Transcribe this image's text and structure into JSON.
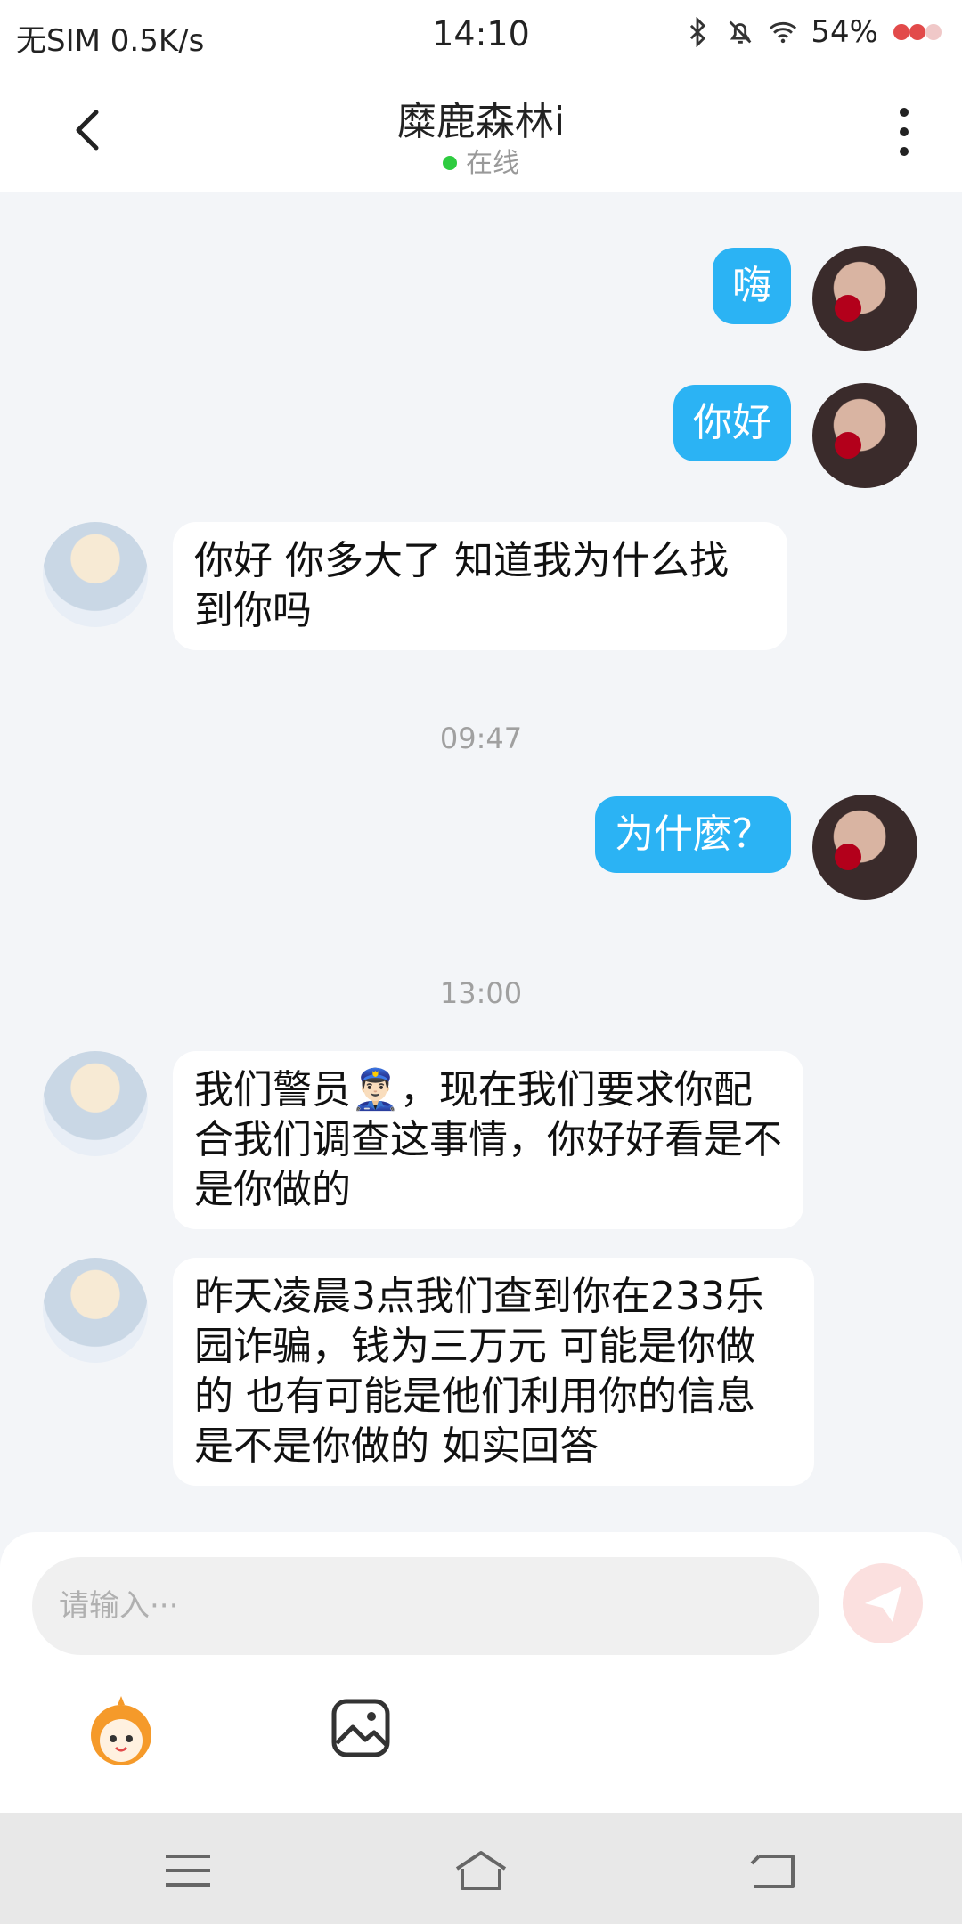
{
  "status_bar": {
    "carrier": "无SIM",
    "speed": "0.5K/s",
    "time": "14:10",
    "battery": "54%"
  },
  "header": {
    "title": "糜鹿森林i",
    "status": "在线"
  },
  "messages": {
    "m1": "嗨",
    "m2": "你好",
    "m3": "你好 你多大了 知道我为什么找到你吗",
    "t1": "09:47",
    "m4": "为什麼？",
    "t2": "13:00",
    "m5": "我们警员👮🏻‍♂️，现在我们要求你配合我们调查这事情，你好好看是不是你做的",
    "m6": "昨天凌晨3点我们查到你在233乐园诈骗，钱为三万元 可能是你做的 也有可能是他们利用你的信息 是不是你做的 如实回答"
  },
  "composer": {
    "placeholder": "请输入···"
  },
  "colors": {
    "outgoing_bubble": "#2bb3f4",
    "incoming_bubble": "#ffffff",
    "online_dot": "#2ecc40",
    "send_button": "#fbe0df"
  },
  "icons": [
    "back-arrow-icon",
    "more-vertical-icon",
    "bluetooth-icon",
    "bell-off-icon",
    "wifi-icon",
    "emoji-mascot-icon",
    "image-icon",
    "send-icon",
    "menu-icon",
    "home-icon",
    "back-nav-icon"
  ]
}
